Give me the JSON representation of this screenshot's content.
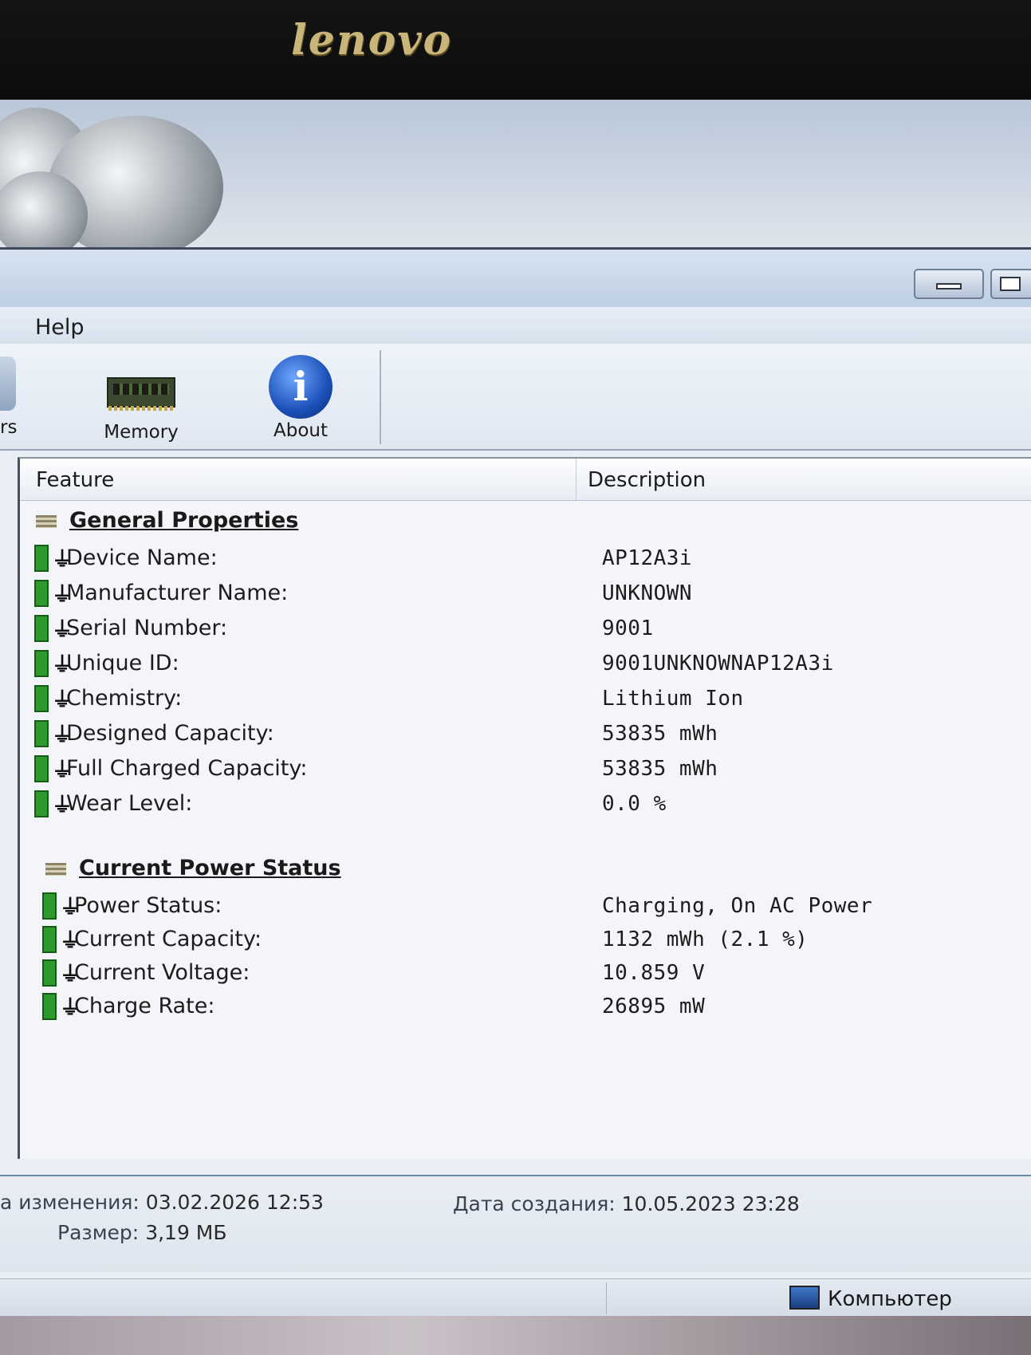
{
  "monitor": {
    "brand": "lenovo"
  },
  "menu": {
    "items": [
      "Help"
    ]
  },
  "toolbar": {
    "partial_label": "rs",
    "buttons": [
      {
        "label": "Memory",
        "icon": "memory-module-icon"
      },
      {
        "label": "About",
        "icon": "info-icon"
      }
    ]
  },
  "list": {
    "columns": {
      "feature": "Feature",
      "description": "Description"
    },
    "sections": [
      {
        "title": "General Properties",
        "rows": [
          {
            "feature": "Device Name:",
            "description": "AP12A3i"
          },
          {
            "feature": "Manufacturer Name:",
            "description": "UNKNOWN"
          },
          {
            "feature": "Serial Number:",
            "description": "9001"
          },
          {
            "feature": "Unique ID:",
            "description": "9001UNKNOWNAP12A3i"
          },
          {
            "feature": "Chemistry:",
            "description": "Lithium Ion"
          },
          {
            "feature": "Designed Capacity:",
            "description": "53835 mWh"
          },
          {
            "feature": "Full Charged Capacity:",
            "description": "53835 mWh"
          },
          {
            "feature": "Wear Level:",
            "description": "0.0 %"
          }
        ]
      },
      {
        "title": "Current Power Status",
        "rows": [
          {
            "feature": "Power Status:",
            "description": "Charging, On AC Power"
          },
          {
            "feature": "Current Capacity:",
            "description": "1132 mWh (2.1 %)"
          },
          {
            "feature": "Current Voltage:",
            "description": "10.859 V"
          },
          {
            "feature": "Charge Rate:",
            "description": "26895 mW"
          }
        ]
      }
    ]
  },
  "details": {
    "modified_label": "а изменения:",
    "modified_value": "03.02.2026 12:53",
    "created_label": "Дата создания:",
    "created_value": "10.05.2023 23:28",
    "size_label": "Размер:",
    "size_value": "3,19 МБ"
  },
  "statusbar": {
    "location": "Компьютер"
  },
  "colors": {
    "battery_green": "#2e9a2e",
    "window_bg": "#e9eef5",
    "accent_blue": "#1b4fb8"
  }
}
